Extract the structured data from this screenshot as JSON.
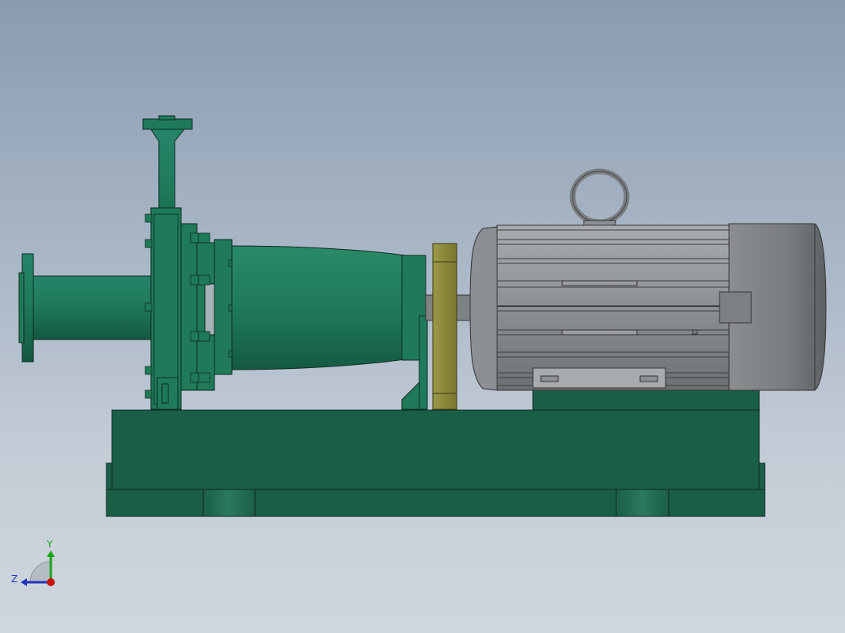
{
  "scene": {
    "model": "centrifugal-pump-with-motor-on-baseplate",
    "background_top": "#8a9bb0",
    "background_bottom": "#d0d6de",
    "pump_color": "#1f7a5a",
    "baseplate_color": "#1b5e48",
    "motor_color": "#8c8f93",
    "coupling_color": "#8e8c3c"
  },
  "triad": {
    "y_label": "Y",
    "z_label": "Z",
    "y_color": "#1aa31a",
    "z_color": "#2233bb",
    "x_color": "#cc1111"
  }
}
